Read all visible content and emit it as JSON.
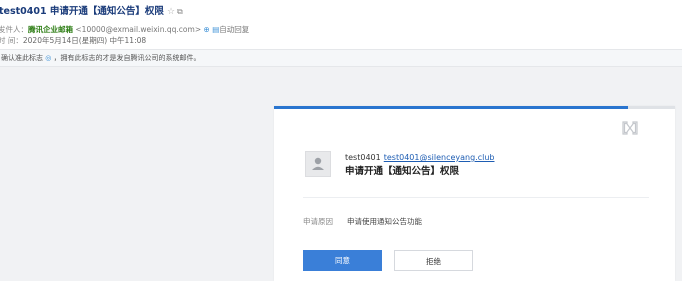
{
  "mail": {
    "subject": "test0401 申请开通【通知公告】权限",
    "from_label": "发件人：",
    "sender_name": "腾讯企业邮箱",
    "sender_addr": "<10000@exmail.weixin.qq.com>",
    "auto_reply": "自动回复",
    "time_label": "时  间：",
    "time_value": "2020年5月14日(星期四) 中午11:08",
    "notice_prefix": "确认准此标志",
    "notice_suffix": "，拥有此标志的才是发自腾讯公司的系统邮件。"
  },
  "card": {
    "requester_id": "test0401",
    "requester_email": "test0401@silenceyang.club",
    "title": "申请开通【通知公告】权限",
    "reason_label": "申请原因",
    "reason_value": "申请使用通知公告功能",
    "approve_label": "同意",
    "reject_label": "拒绝"
  },
  "colors": {
    "accent": "#3a7fd8",
    "top_bar": "#2a75cf",
    "sender": "#2d7d14",
    "link": "#1e5db3"
  }
}
